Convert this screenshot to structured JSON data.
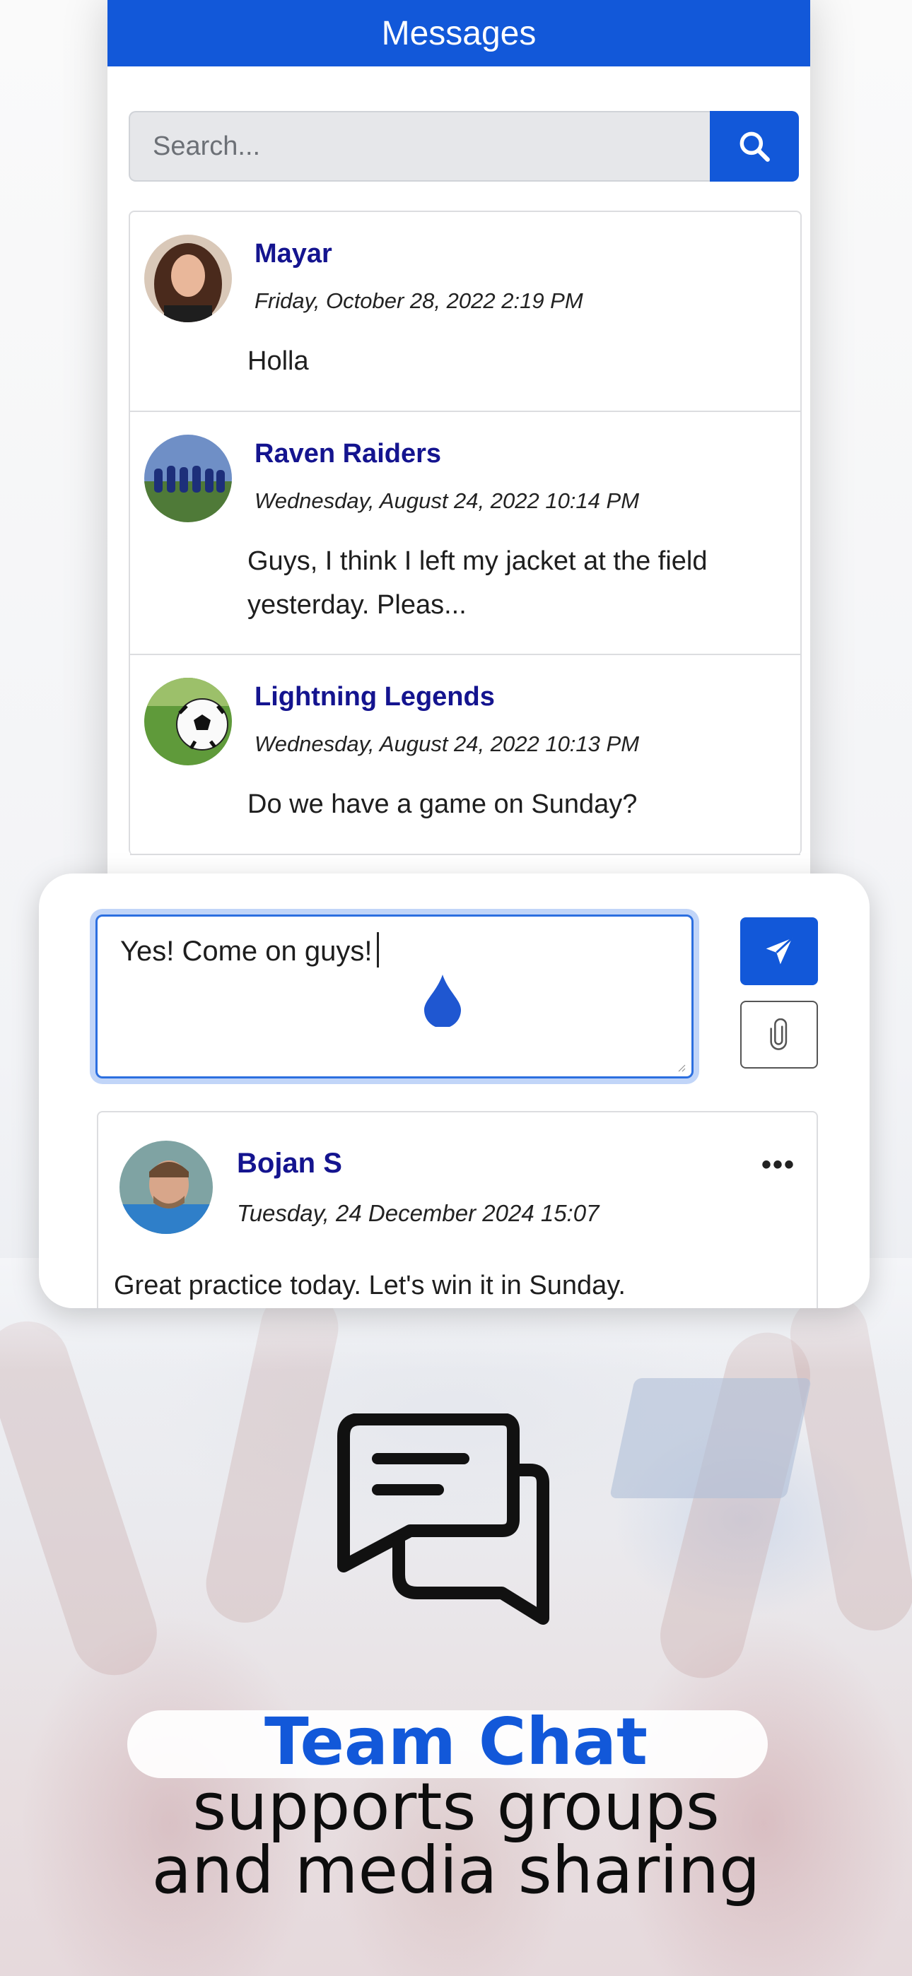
{
  "header": {
    "title": "Messages"
  },
  "search": {
    "placeholder": "Search..."
  },
  "messages": [
    {
      "name": "Mayar",
      "date": "Friday, October 28, 2022 2:19 PM",
      "text": "Holla"
    },
    {
      "name": "Raven Raiders",
      "date": "Wednesday, August 24, 2022 10:14 PM",
      "text": "Guys, I think I left my jacket at the field yesterday. Pleas..."
    },
    {
      "name": "Lightning Legends",
      "date": "Wednesday, August 24, 2022 10:13 PM",
      "text": "Do we have a game on Sunday?"
    }
  ],
  "compose": {
    "text": "Yes! Come on guys!"
  },
  "post": {
    "name": "Bojan S",
    "date": "Tuesday, 24 December 2024 15:07",
    "text": "Great practice today. Let's win it in Sunday.",
    "more": "•••"
  },
  "promo": {
    "title": "Team Chat",
    "line1": "supports groups",
    "line2": "and media sharing"
  },
  "colors": {
    "accent": "#1258d9",
    "name": "#14148f"
  },
  "icons": [
    "search-icon",
    "send-icon",
    "paperclip-icon",
    "chat-bubbles-icon",
    "more-icon"
  ]
}
